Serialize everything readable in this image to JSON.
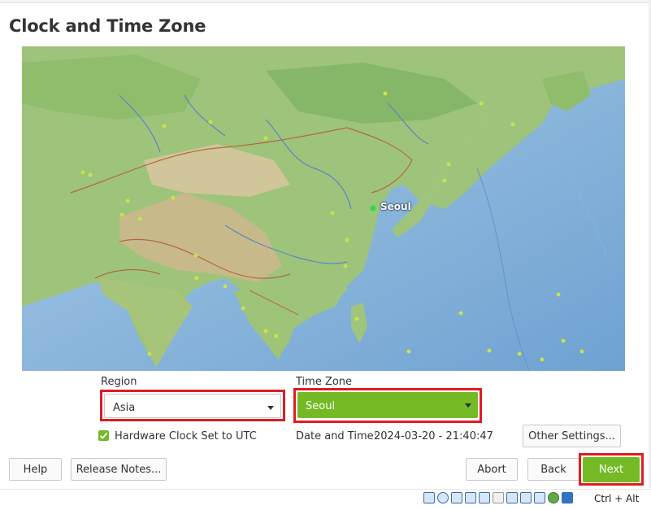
{
  "page": {
    "title": "Clock and Time Zone"
  },
  "map": {
    "highlighted_city": "Seoul"
  },
  "region": {
    "label": "Region",
    "value": "Asia"
  },
  "timezone": {
    "label": "Time Zone",
    "value": "Seoul"
  },
  "hardware_clock": {
    "label": "Hardware Clock Set to UTC",
    "checked": true
  },
  "datetime": {
    "label": "Date and Time:",
    "value": "2024-03-20 - 21:40:47"
  },
  "buttons": {
    "other_settings": "Other Settings...",
    "help": "Help",
    "release_notes": "Release Notes...",
    "abort": "Abort",
    "back": "Back",
    "next": "Next"
  },
  "statusbar": {
    "host_key": "Ctrl + Alt",
    "icons": [
      "hard-disk-icon",
      "optical-drive-icon",
      "audio-icon",
      "network-icon",
      "usb-icon",
      "shared-folder-icon",
      "display-icon",
      "video-capture-icon",
      "recording-icon",
      "cpu-icon",
      "mouse-integration-icon"
    ]
  },
  "colors": {
    "accent": "#73ba25",
    "highlight": "#e01b24",
    "ocean": "#8db8de",
    "land": "#9cc477"
  }
}
